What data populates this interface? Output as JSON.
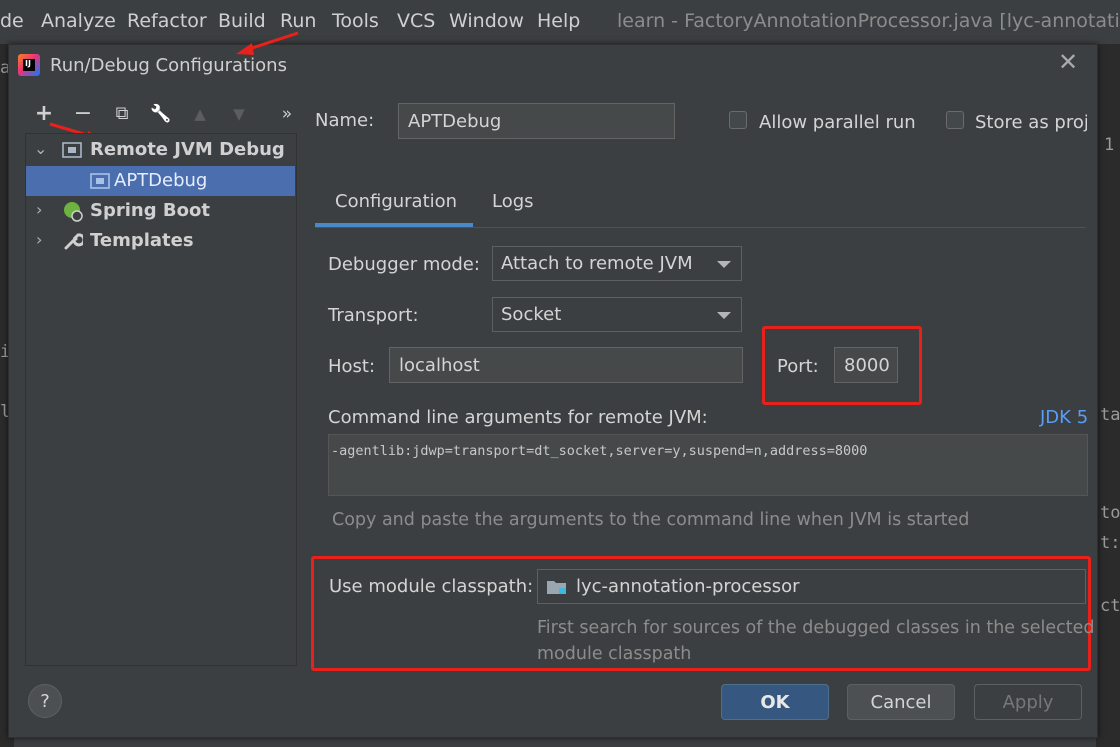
{
  "menubar": {
    "items": [
      "de",
      "Analyze",
      "Refactor",
      "Build",
      "Run",
      "Tools",
      "VCS",
      "Window",
      "Help"
    ],
    "window_title": "learn - FactoryAnnotationProcessor.java [lyc-annotation-pr"
  },
  "dialog": {
    "title": "Run/Debug Configurations",
    "close_glyph": "✕"
  },
  "toolbar": {
    "add": "+",
    "remove": "−",
    "copy": "⧉",
    "edit": "🔧",
    "up": "▲",
    "down": "▼",
    "more": "»"
  },
  "tree": {
    "items": [
      {
        "label": "Remote JVM Debug",
        "expanded": true
      },
      {
        "label": "APTDebug",
        "selected": true
      },
      {
        "label": "Spring Boot",
        "expanded": false
      },
      {
        "label": "Templates",
        "expanded": false
      }
    ]
  },
  "form": {
    "name_label": "Name:",
    "name_value": "APTDebug",
    "allow_parallel_label": "Allow parallel run",
    "store_project_label": "Store as proje",
    "tabs": [
      "Configuration",
      "Logs"
    ],
    "debugger_mode_label": "Debugger mode:",
    "debugger_mode_value": "Attach to remote JVM",
    "transport_label": "Transport:",
    "transport_value": "Socket",
    "host_label": "Host:",
    "host_value": "localhost",
    "port_label": "Port:",
    "port_value": "8000",
    "cmd_label": "Command line arguments for remote JVM:",
    "jdk_link": "JDK 5",
    "cmd_value": "-agentlib:jdwp=transport=dt_socket,server=y,suspend=n,address=8000",
    "cmd_hint": "Copy and paste the arguments to the command line when JVM is started",
    "classpath_label": "Use module classpath:",
    "classpath_value": "lyc-annotation-processor",
    "classpath_hint_1": "First search for sources of the debugged classes in the selected",
    "classpath_hint_2": "module classpath"
  },
  "buttons": {
    "help": "?",
    "ok": "OK",
    "cancel": "Cancel",
    "apply": "Apply"
  },
  "ide_fragments": {
    "left": [
      "a",
      "i",
      "le"
    ],
    "right": [
      "1",
      "ta",
      "to",
      "t:",
      "ct"
    ]
  },
  "colors": {
    "accent_blue": "#4b6eaf",
    "link_blue": "#589df6",
    "annotation_red": "#e8221b"
  }
}
